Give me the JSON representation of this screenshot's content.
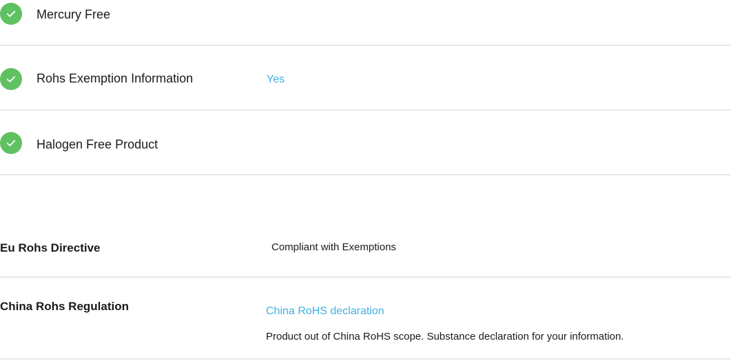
{
  "features": [
    {
      "label": "Mercury Free",
      "value": "",
      "icon": "check-circle-icon"
    },
    {
      "label": "Rohs Exemption Information",
      "value": "Yes",
      "icon": "check-circle-icon"
    },
    {
      "label": "Halogen Free Product",
      "value": "",
      "icon": "check-circle-icon"
    }
  ],
  "specs": [
    {
      "label": "Eu Rohs Directive",
      "value": "Compliant with Exemptions"
    },
    {
      "label": "China Rohs Regulation",
      "link": "China RoHS declaration",
      "note": "Product out of China RoHS scope. Substance declaration for your information."
    }
  ],
  "colors": {
    "check": "#5fc161",
    "link": "#3fb1e3",
    "divider": "#e8e8e8"
  }
}
